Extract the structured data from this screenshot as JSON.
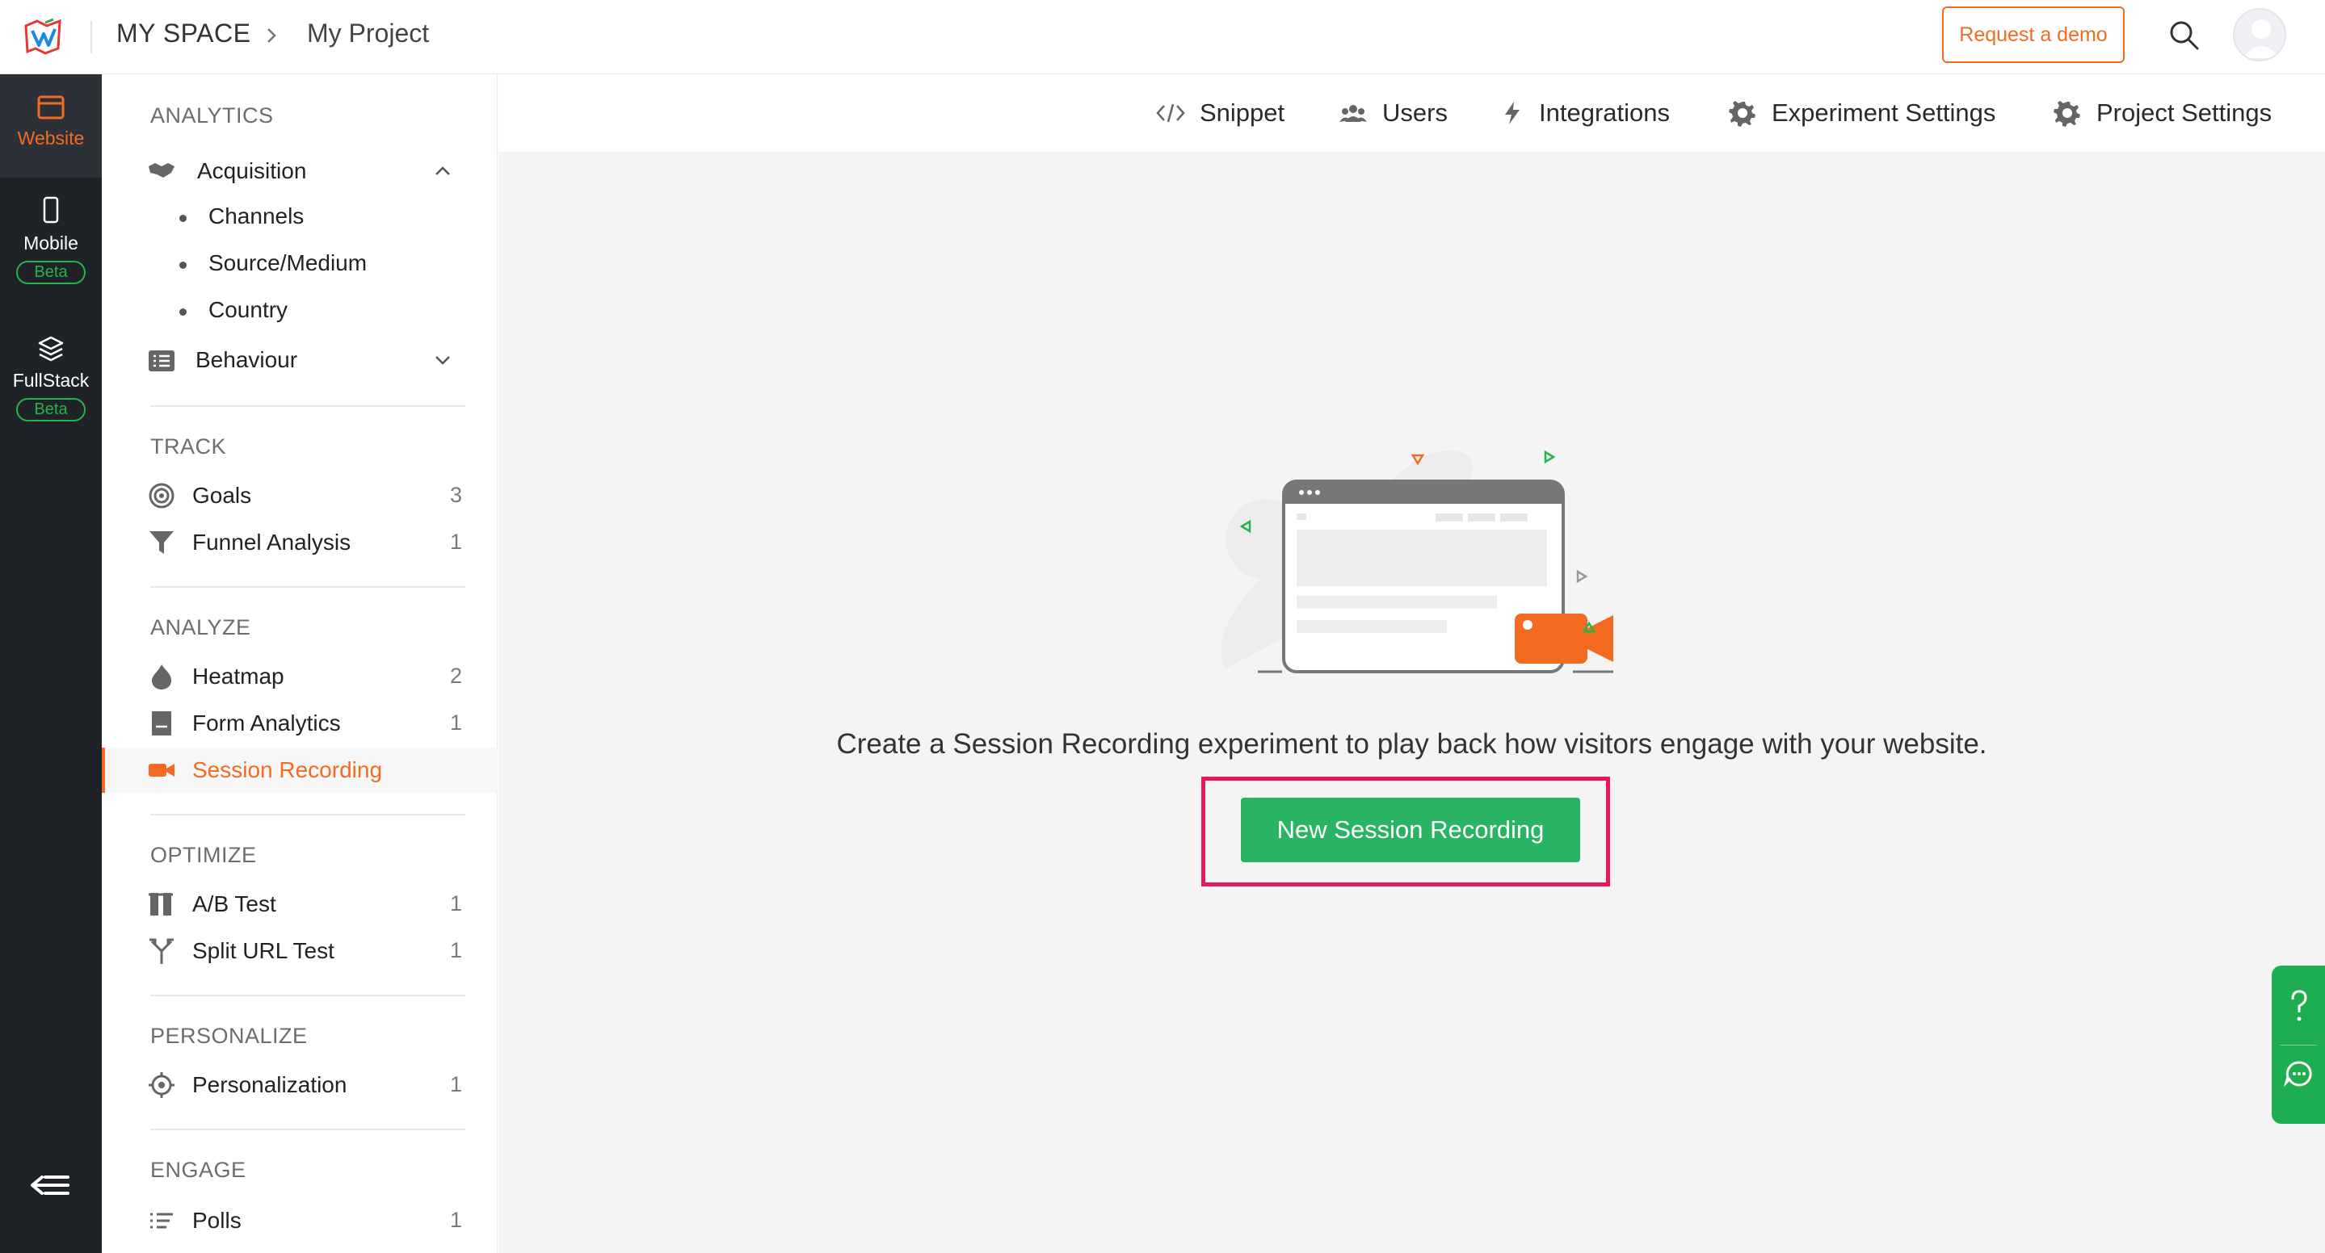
{
  "header": {
    "breadcrumb_root": "MY SPACE",
    "breadcrumb_current": "My Project",
    "request_demo_label": "Request a demo",
    "accent_color": "#f26b21"
  },
  "rail": {
    "items": [
      {
        "label": "Website",
        "icon": "browser-icon",
        "active": true
      },
      {
        "label": "Mobile",
        "icon": "mobile-icon",
        "badge": "Beta"
      },
      {
        "label": "FullStack",
        "icon": "layers-icon",
        "badge": "Beta"
      }
    ]
  },
  "sidebar": {
    "sections": {
      "analytics": "ANALYTICS",
      "track": "TRACK",
      "analyze": "ANALYZE",
      "optimize": "OPTIMIZE",
      "personalize": "PERSONALIZE",
      "engage": "ENGAGE"
    },
    "acquisition": {
      "label": "Acquisition",
      "children": [
        "Channels",
        "Source/Medium",
        "Country"
      ]
    },
    "behaviour": {
      "label": "Behaviour"
    },
    "goals": {
      "label": "Goals",
      "count": "3"
    },
    "funnel": {
      "label": "Funnel Analysis",
      "count": "1"
    },
    "heatmap": {
      "label": "Heatmap",
      "count": "2"
    },
    "form_analytics": {
      "label": "Form Analytics",
      "count": "1"
    },
    "session_recording": {
      "label": "Session Recording",
      "active": true
    },
    "ab_test": {
      "label": "A/B Test",
      "count": "1"
    },
    "split_url": {
      "label": "Split URL Test",
      "count": "1"
    },
    "personalization": {
      "label": "Personalization",
      "count": "1"
    },
    "polls": {
      "label": "Polls",
      "count": "1"
    }
  },
  "tabs": [
    {
      "label": "Snippet",
      "icon": "code-icon"
    },
    {
      "label": "Users",
      "icon": "users-icon"
    },
    {
      "label": "Integrations",
      "icon": "bolt-icon"
    },
    {
      "label": "Experiment Settings",
      "icon": "gear-icon"
    },
    {
      "label": "Project Settings",
      "icon": "gear-icon"
    }
  ],
  "main": {
    "message": "Create a Session Recording experiment to play back how visitors engage with your website.",
    "cta_label": "New Session Recording",
    "cta_color": "#28b463",
    "highlight_color": "#e8175d"
  }
}
